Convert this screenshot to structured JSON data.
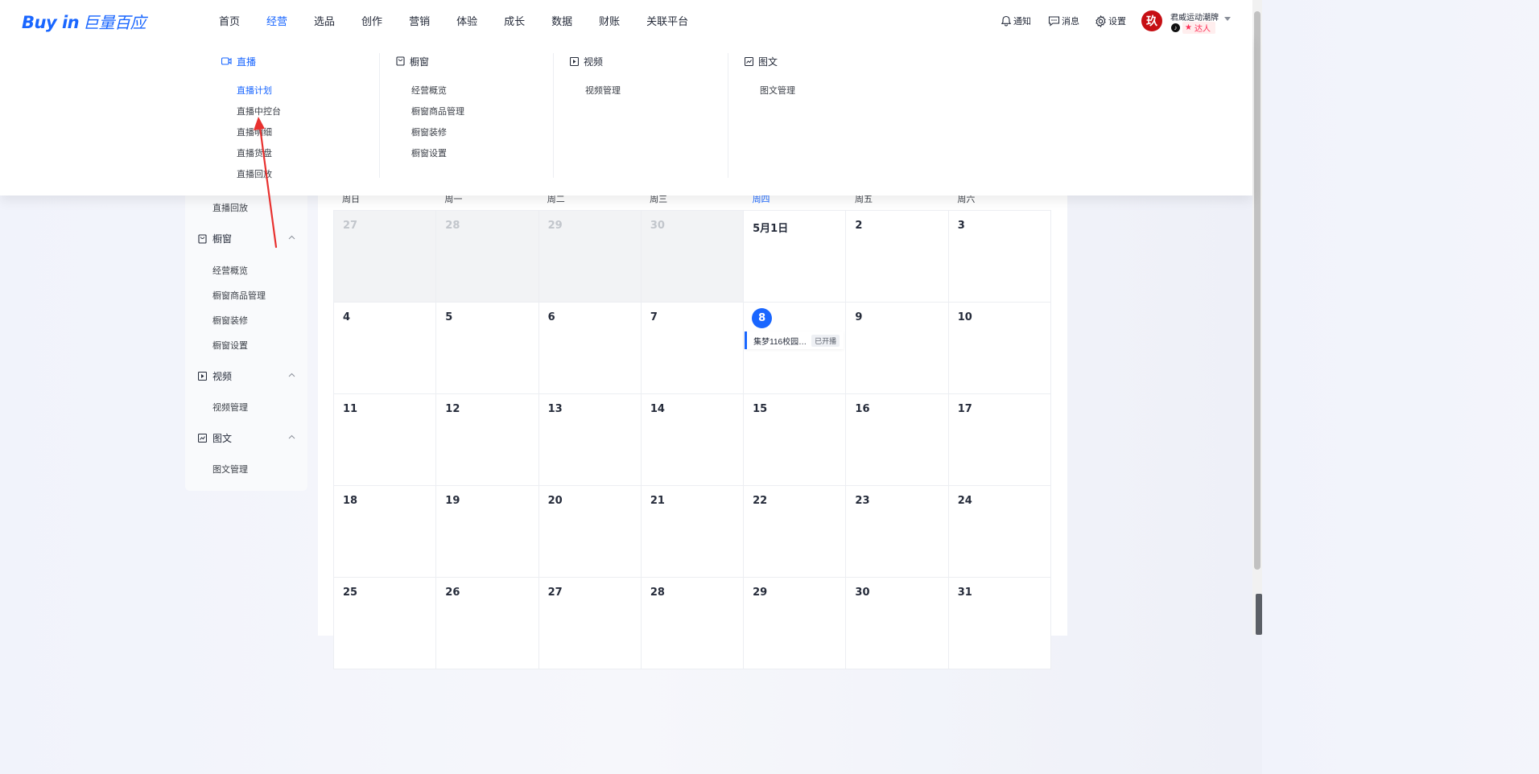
{
  "logo": {
    "brand": "Buy in",
    "cn": "巨量百应"
  },
  "nav": [
    "首页",
    "经营",
    "选品",
    "创作",
    "营销",
    "体验",
    "成长",
    "数据",
    "财账",
    "关联平台"
  ],
  "nav_active": "经营",
  "top_right": {
    "notify": "通知",
    "message": "消息",
    "settings": "设置"
  },
  "user": {
    "avatar_char": "玖",
    "name": "君威运动潮牌",
    "tag": "达人"
  },
  "mega": {
    "live": {
      "title": "直播",
      "items": [
        "直播计划",
        "直播中控台",
        "直播明细",
        "直播货盘",
        "直播回放"
      ]
    },
    "window": {
      "title": "橱窗",
      "items": [
        "经营概览",
        "橱窗商品管理",
        "橱窗装修",
        "橱窗设置"
      ]
    },
    "video": {
      "title": "视频",
      "items": [
        "视频管理"
      ]
    },
    "article": {
      "title": "图文",
      "items": [
        "图文管理"
      ]
    }
  },
  "sidebar": {
    "live_last": "直播回放",
    "window": {
      "title": "橱窗",
      "items": [
        "经营概览",
        "橱窗商品管理",
        "橱窗装修",
        "橱窗设置"
      ]
    },
    "video": {
      "title": "视频",
      "items": [
        "视频管理"
      ]
    },
    "article": {
      "title": "图文",
      "items": [
        "图文管理"
      ]
    }
  },
  "calendar": {
    "weekdays": [
      "周日",
      "周一",
      "周二",
      "周三",
      "周四",
      "周五",
      "周六"
    ],
    "today_weekday_index": 4,
    "weeks": [
      [
        "27",
        "28",
        "29",
        "30",
        "5月1日",
        "2",
        "3"
      ],
      [
        "4",
        "5",
        "6",
        "7",
        "8",
        "9",
        "10"
      ],
      [
        "11",
        "12",
        "13",
        "14",
        "15",
        "16",
        "17"
      ],
      [
        "18",
        "19",
        "20",
        "21",
        "22",
        "23",
        "24"
      ],
      [
        "25",
        "26",
        "27",
        "28",
        "29",
        "30",
        "31"
      ]
    ],
    "muted_first_row_count": 4,
    "today": "8",
    "event": {
      "title": "集梦116校园…",
      "status": "已开播"
    }
  },
  "colors": {
    "accent": "#1966ff",
    "arrow": "#e8312f"
  }
}
